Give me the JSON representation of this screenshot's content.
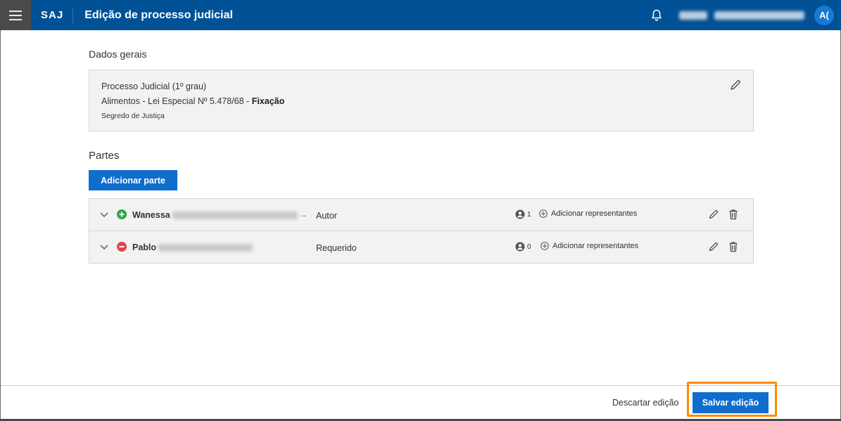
{
  "header": {
    "brand": "SAJ",
    "title": "Edição de processo judicial",
    "avatar_initials": "A(",
    "bg_color": "#005195"
  },
  "general": {
    "section_title": "Dados gerais",
    "line1": "Processo Judicial (1º grau)",
    "line2_prefix": "Alimentos - Lei Especial Nº 5.478/68 - ",
    "line2_bold": "Fixação",
    "line3": "Segredo de Justiça"
  },
  "parts": {
    "section_title": "Partes",
    "add_button_label": "Adicionar parte",
    "rows": [
      {
        "first_name": "Wanessa",
        "truncation": "..",
        "role": "Autor",
        "status": "positive",
        "status_color": "#28a745",
        "representatives_count": "1",
        "add_representatives_label": "Adicionar representantes"
      },
      {
        "first_name": "Pablo",
        "role": "Requerido",
        "status": "negative",
        "status_color": "#e0454d",
        "representatives_count": "0",
        "add_representatives_label": "Adicionar representantes"
      }
    ]
  },
  "footer": {
    "discard_label": "Descartar edição",
    "save_label": "Salvar edição",
    "highlight_color": "#ff8a00"
  }
}
